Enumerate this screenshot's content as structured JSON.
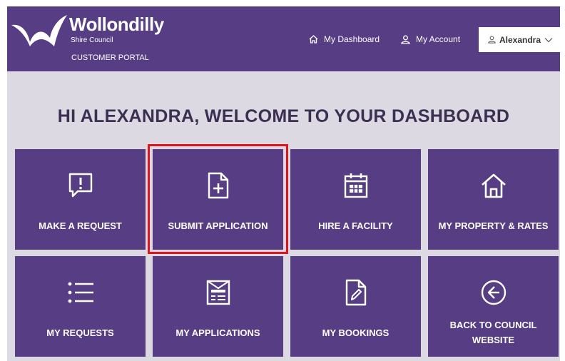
{
  "header": {
    "brand_name": "Wollondilly",
    "brand_sub": "Shire Council",
    "brand_portal": "CUSTOMER PORTAL",
    "nav": {
      "dashboard": "My Dashboard",
      "account": "My Account"
    },
    "user": {
      "name": "Alexandra"
    }
  },
  "welcome": "HI ALEXANDRA, WELCOME TO YOUR DASHBOARD",
  "tiles": [
    {
      "label": "MAKE A REQUEST",
      "icon": "speech-bubble-exclamation-icon"
    },
    {
      "label": "SUBMIT APPLICATION",
      "icon": "document-plus-icon"
    },
    {
      "label": "HIRE A FACILITY",
      "icon": "calendar-icon"
    },
    {
      "label": "MY PROPERTY & RATES",
      "icon": "house-icon"
    },
    {
      "label": "MY REQUESTS",
      "icon": "list-icon"
    },
    {
      "label": "MY APPLICATIONS",
      "icon": "form-document-icon"
    },
    {
      "label": "MY BOOKINGS",
      "icon": "document-pen-icon"
    },
    {
      "label": "BACK TO COUNCIL WEBSITE",
      "icon": "arrow-left-circle-icon"
    }
  ],
  "colors": {
    "header_bg": "#573d84",
    "tile_bg": "#573d84",
    "page_bg": "#ddd9e3",
    "highlight": "#e0141e"
  }
}
